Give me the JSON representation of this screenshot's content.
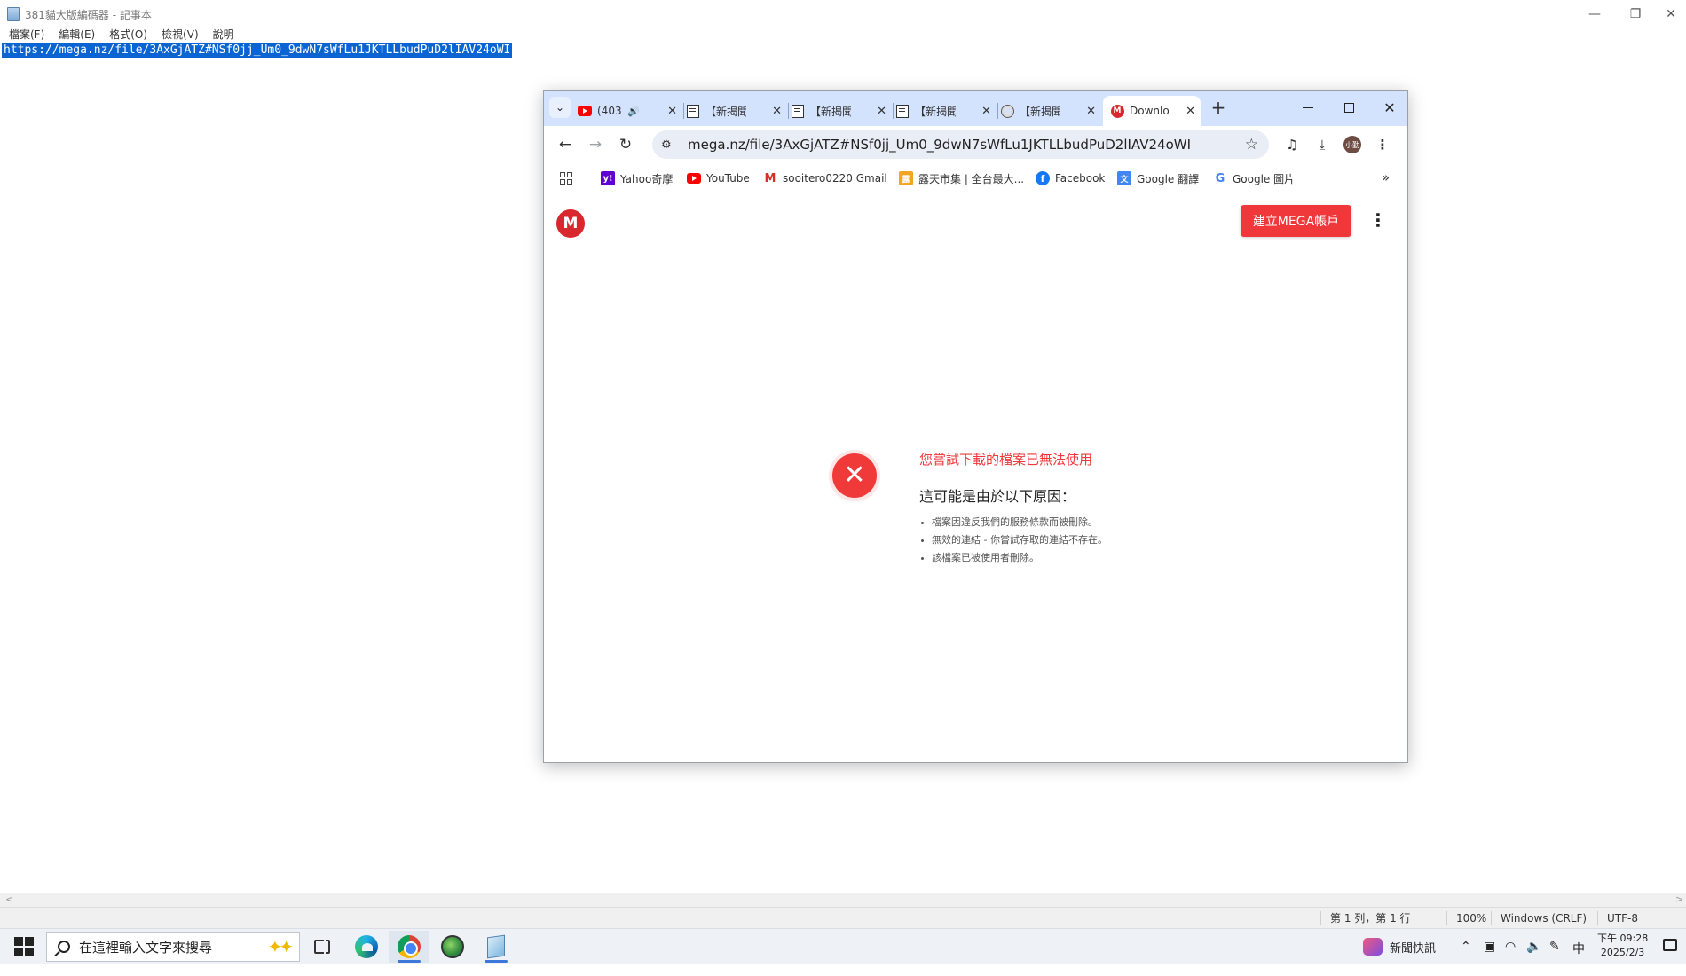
{
  "notepad": {
    "title": "381貓大版編碼器 - 記事本",
    "menu": [
      "檔案(F)",
      "編輯(E)",
      "格式(O)",
      "檢視(V)",
      "說明"
    ],
    "content": "https://mega.nz/file/3AxGjATZ#NSf0jj_Um0_9dwN7sWfLu1JKTLLbudPuD2lIAV24oWI",
    "status": {
      "position": "第 1 列，第 1 行",
      "zoom": "100%",
      "line_ending": "Windows (CRLF)",
      "encoding": "UTF-8"
    }
  },
  "browser": {
    "tabs": [
      {
        "icon": "youtube-icon",
        "title": "(403",
        "muted_icon": "speaker-icon"
      },
      {
        "icon": "document-icon",
        "title": "【新揭聞"
      },
      {
        "icon": "document-icon",
        "title": "【新揭聞"
      },
      {
        "icon": "document-icon",
        "title": "【新揭聞"
      },
      {
        "icon": "globe-icon",
        "title": "【新揭聞"
      },
      {
        "icon": "mega-icon",
        "title": "Downlo",
        "active": true
      }
    ],
    "new_tab": "+",
    "address": "mega.nz/file/3AxGjATZ#NSf0jj_Um0_9dwN7sWfLu1JKTLLbudPuD2lIAV24oWI",
    "profile_initials": "小勤",
    "bookmarks": [
      {
        "icon": "yahoo-icon",
        "label": "Yahoo奇摩"
      },
      {
        "icon": "youtube-icon",
        "label": "YouTube"
      },
      {
        "icon": "gmail-icon",
        "label": "sooitero0220 Gmail"
      },
      {
        "icon": "store-icon",
        "label": "露天市集 | 全台最大..."
      },
      {
        "icon": "facebook-icon",
        "label": "Facebook"
      },
      {
        "icon": "google-translate-icon",
        "label": "Google 翻譯"
      },
      {
        "icon": "google-icon",
        "label": "Google 圖片"
      }
    ]
  },
  "mega": {
    "logo": "M",
    "create_account": "建立MEGA帳戶",
    "error_title": "您嘗試下載的檔案已無法使用",
    "error_subtitle": "這可能是由於以下原因：",
    "reasons": [
      "檔案因違反我們的服務條款而被刪除。",
      "無效的連結 - 你嘗試存取的連結不存在。",
      "該檔案已被使用者刪除。"
    ]
  },
  "taskbar": {
    "search_placeholder": "在這裡輸入文字來搜尋",
    "news": "新聞快訊",
    "ime": "中",
    "time": "下午 09:28",
    "date": "2025/2/3"
  },
  "colors": {
    "mega_red": "#f0373a",
    "selection_blue": "#0a64d2",
    "tabstrip": "#d3e3fd"
  }
}
